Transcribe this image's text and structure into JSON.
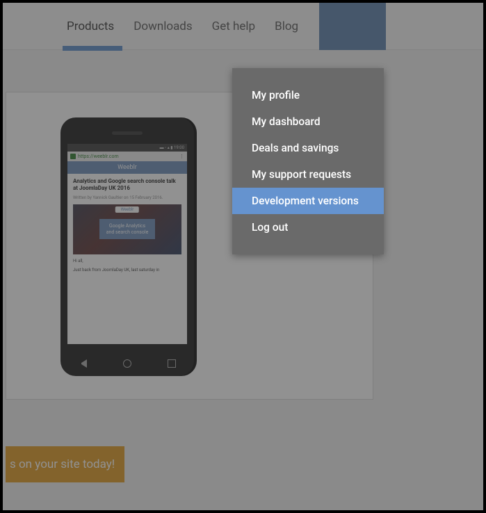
{
  "nav": {
    "items": [
      "Products",
      "Downloads",
      "Get help",
      "Blog"
    ],
    "active_index": 0
  },
  "dropdown": {
    "items": [
      "My profile",
      "My dashboard",
      "Deals and savings",
      "My support requests",
      "Development versions",
      "Log out"
    ],
    "highlighted_index": 4
  },
  "phone": {
    "status_time": "19:00",
    "url_host": "https://weeblr.com",
    "banner": "Weeblr",
    "article_title": "Analytics and Google search console talk at JoomlaDay UK 2016",
    "article_meta": "Written by Yannick Gaultier on 15 February 2016.",
    "img_logo": "Weeblr",
    "img_btn_line1": "Google Analytics",
    "img_btn_line2": "and search console",
    "body_greeting": "Hi all,",
    "body_text": "Just back from JoomlaDay UK, last saturday in"
  },
  "cta": {
    "text": "s on your site today!"
  }
}
